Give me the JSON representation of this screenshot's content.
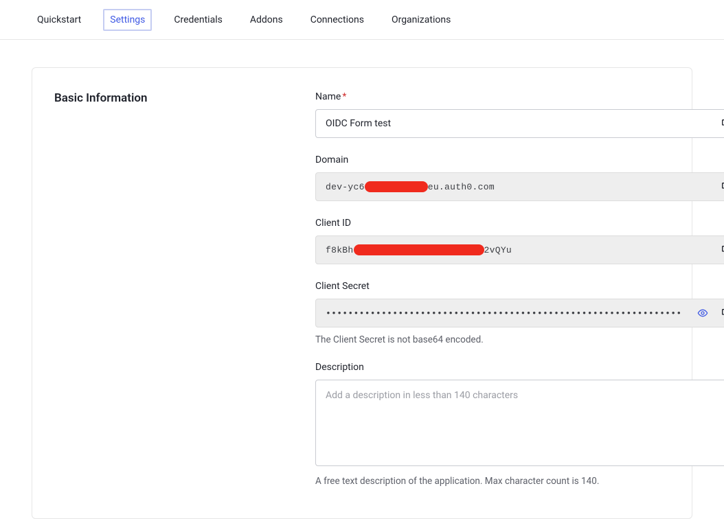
{
  "tabs": {
    "quickstart": "Quickstart",
    "settings": "Settings",
    "credentials": "Credentials",
    "addons": "Addons",
    "connections": "Connections",
    "organizations": "Organizations"
  },
  "section": {
    "title": "Basic Information"
  },
  "fields": {
    "name": {
      "label": "Name",
      "value": "OIDC Form test"
    },
    "domain": {
      "label": "Domain",
      "prefix": "dev-yc6",
      "suffix": "eu.auth0.com"
    },
    "client_id": {
      "label": "Client ID",
      "prefix": "f8kBh",
      "suffix": "2vQYu"
    },
    "client_secret": {
      "label": "Client Secret",
      "masked": "••••••••••••••••••••••••••••••••••••••••••••••••••••••••••••••••",
      "help": "The Client Secret is not base64 encoded."
    },
    "description": {
      "label": "Description",
      "value": "",
      "placeholder": "Add a description in less than 140 characters",
      "help": "A free text description of the application. Max character count is 140."
    }
  }
}
